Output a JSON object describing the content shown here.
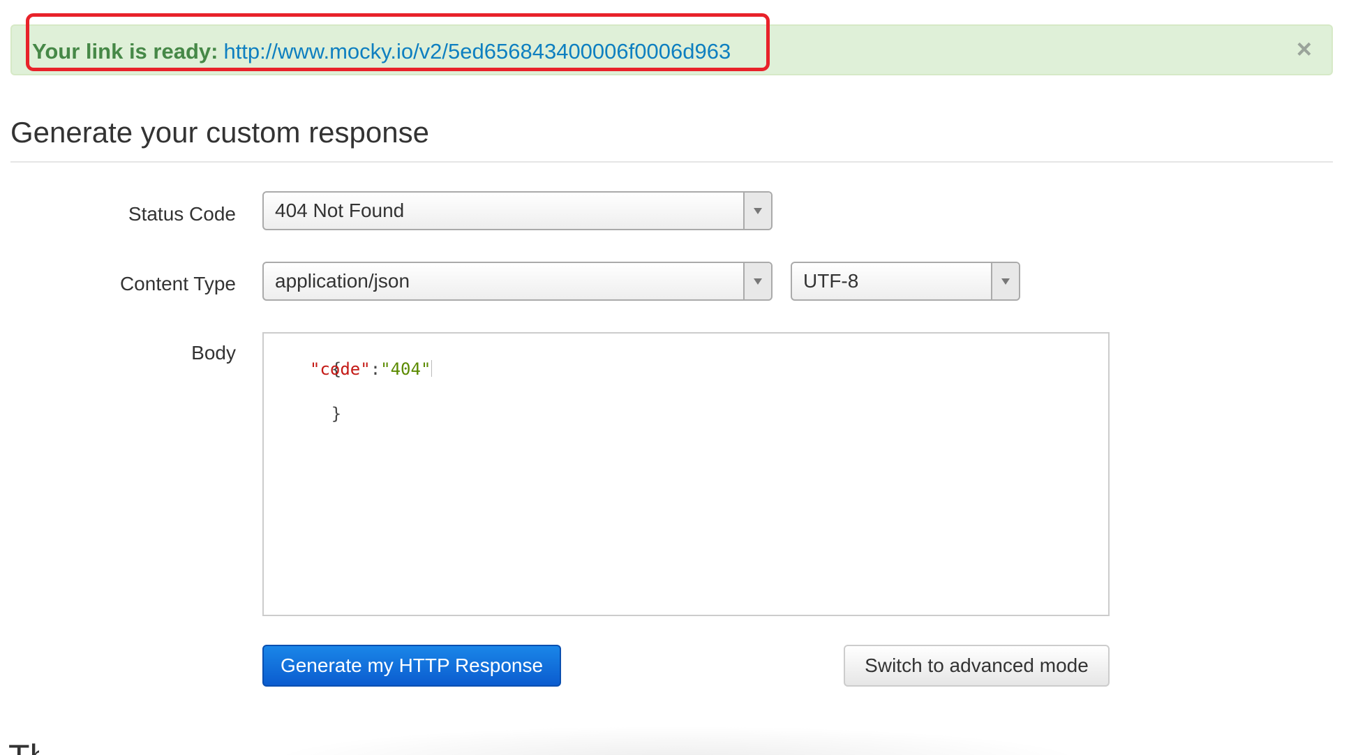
{
  "alert": {
    "label": "Your link is ready:",
    "link": "http://www.mocky.io/v2/5ed656843400006f0006d963",
    "close_glyph": "×"
  },
  "page": {
    "title": "Generate your custom response",
    "bottom_heading_partial": "Th"
  },
  "form": {
    "status_code": {
      "label": "Status Code",
      "value": "404 Not Found"
    },
    "content_type": {
      "label": "Content Type",
      "value": "application/json"
    },
    "charset": {
      "value": "UTF-8"
    },
    "body": {
      "label": "Body",
      "lines": {
        "open": "{",
        "key": "\"code\"",
        "colon": ":",
        "value": "\"404\"",
        "close": "}"
      }
    }
  },
  "buttons": {
    "generate": "Generate my HTTP Response",
    "advanced": "Switch to advanced mode"
  },
  "colors": {
    "alert_bg": "#dff0d8",
    "alert_label": "#468847",
    "link": "#0e7fc0",
    "highlight_border": "#e8222a",
    "primary_button": "#0b5ccf",
    "json_key": "#c41a16",
    "json_string": "#5b8a00"
  }
}
